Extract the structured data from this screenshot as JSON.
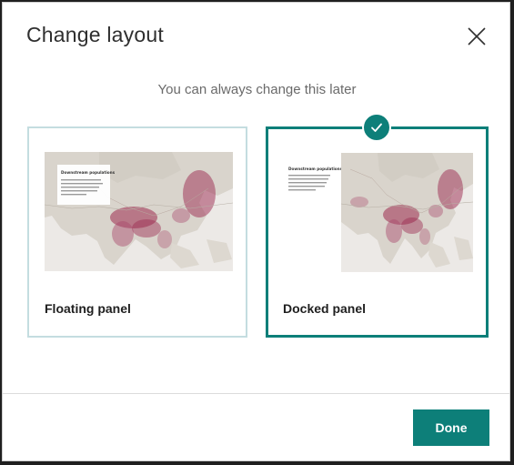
{
  "dialog": {
    "title": "Change layout",
    "subtitle": "You can always change this later",
    "done_label": "Done"
  },
  "options": [
    {
      "label": "Floating panel",
      "selected": false,
      "preview_heading": "Downstream populations"
    },
    {
      "label": "Docked panel",
      "selected": true,
      "preview_heading": "Downstream populations"
    }
  ],
  "colors": {
    "accent": "#0d7f79",
    "unselected_border": "#c4dde0",
    "map_land": "#d9d4cc",
    "map_water": "#ece9e6",
    "population_heat": "#9c2a4f"
  },
  "icons": {
    "close": "close-icon",
    "check": "check-icon"
  }
}
